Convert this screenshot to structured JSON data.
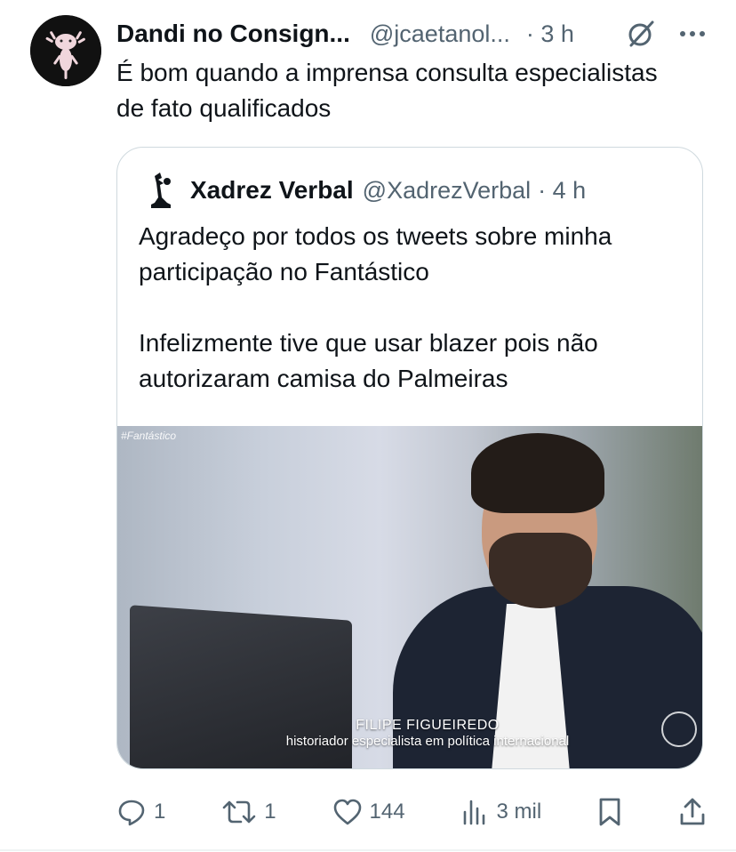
{
  "tweet": {
    "author_name": "Dandi no Consign...",
    "author_handle": "@jcaetanol...",
    "time": "· 3 h",
    "text": "É bom quando a imprensa consulta especialistas de fato qualificados"
  },
  "quoted_tweet": {
    "author_name": "Xadrez Verbal",
    "author_handle": "@XadrezVerbal",
    "time": "· 4 h",
    "paragraphs": [
      "Agradeço por todos os tweets sobre minha participação no Fantástico",
      "Infelizmente tive que usar blazer pois não autorizaram camisa do Palmeiras"
    ],
    "media": {
      "tag": "#Fantástico",
      "caption_name": "FILIPE FIGUEIREDO",
      "caption_role": "historiador especialista em política internacional"
    }
  },
  "actions": {
    "reply_count": "1",
    "retweet_count": "1",
    "like_count": "144",
    "views_count": "3 mil"
  },
  "colors": {
    "text": "#0f1419",
    "secondary": "#536471",
    "border": "#cfd9de"
  }
}
